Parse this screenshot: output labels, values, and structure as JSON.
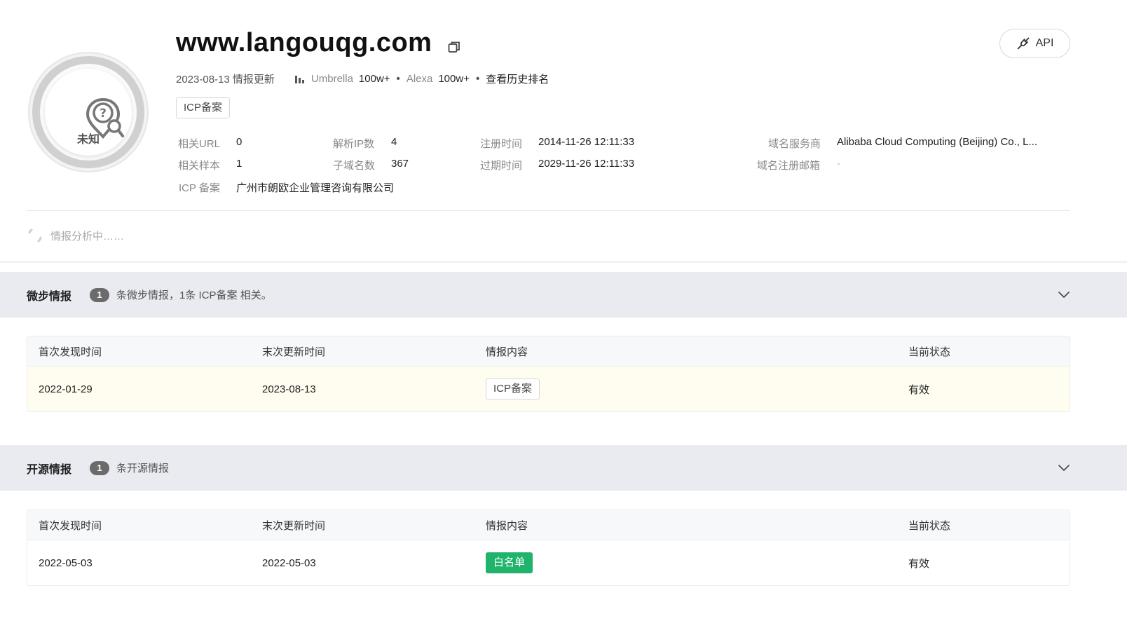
{
  "domain": "www.langouqg.com",
  "badge": {
    "label": "未知"
  },
  "api_button": {
    "label": "API"
  },
  "meta": {
    "update": "2023-08-13 情报更新",
    "umbrella_label": "Umbrella",
    "umbrella_value": "100w+",
    "alexa_label": "Alexa",
    "alexa_value": "100w+",
    "history_link": "查看历史排名"
  },
  "top_tag": "ICP备案",
  "info": {
    "related_url_label": "相关URL",
    "related_url_value": "0",
    "related_sample_label": "相关样本",
    "related_sample_value": "1",
    "icp_label": "ICP 备案",
    "icp_value": "广州市朗欧企业管理咨询有限公司",
    "resolved_ip_label": "解析IP数",
    "resolved_ip_value": "4",
    "subdomain_label": "子域名数",
    "subdomain_value": "367",
    "reg_time_label": "注册时间",
    "reg_time_value": "2014-11-26 12:11:33",
    "exp_time_label": "过期时间",
    "exp_time_value": "2029-11-26 12:11:33",
    "registrar_label": "域名服务商",
    "registrar_value": "Alibaba Cloud Computing (Beijing) Co., L...",
    "reg_email_label": "域名注册邮箱",
    "reg_email_value": "-"
  },
  "analyzing_text": "情报分析中……",
  "sections": [
    {
      "title": "微步情报",
      "count": "1",
      "desc": "条微步情报，1条 ICP备案 相关。",
      "headers": [
        "首次发现时间",
        "末次更新时间",
        "情报内容",
        "当前状态"
      ],
      "row": {
        "first": "2022-01-29",
        "last": "2023-08-13",
        "content": "ICP备案",
        "status": "有效"
      }
    },
    {
      "title": "开源情报",
      "count": "1",
      "desc": "条开源情报",
      "headers": [
        "首次发现时间",
        "末次更新时间",
        "情报内容",
        "当前状态"
      ],
      "row": {
        "first": "2022-05-03",
        "last": "2022-05-03",
        "content": "白名单",
        "status": "有效"
      }
    }
  ],
  "colors": {
    "valid": "#22b36b",
    "whitelist_tag": "#1fb36b",
    "section_bg": "#e9ebf1",
    "row_highlight": "#fffdf0"
  }
}
